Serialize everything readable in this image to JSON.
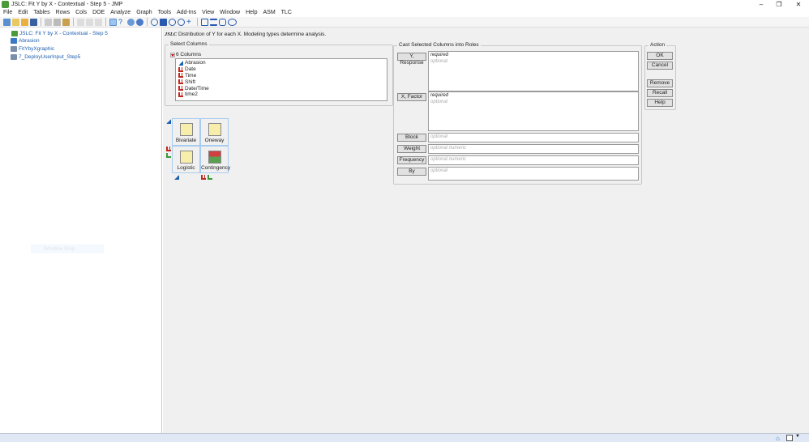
{
  "window": {
    "title": "JSLC: Fit Y by X - Contextual - Step 5 - JMP"
  },
  "menu": [
    "File",
    "Edit",
    "Tables",
    "Rows",
    "Cols",
    "DOE",
    "Analyze",
    "Graph",
    "Tools",
    "Add-Ins",
    "View",
    "Window",
    "Help",
    "ASM",
    "TLC"
  ],
  "tree": [
    "JSLC: Fit Y by X - Contextual - Step 5",
    "Abrasion",
    "FitYbyXgraphic",
    "7_DeployUserInput_Step5"
  ],
  "snip": "Window Snip",
  "header": {
    "badge": "JSLC",
    "text": "Distribution of Y for each X.  Modeling types determine analysis."
  },
  "select": {
    "legend": "Select Columns",
    "count": "6 Columns",
    "columns": [
      {
        "name": "Abrasion",
        "type": "continuous"
      },
      {
        "name": "Date",
        "type": "nominal"
      },
      {
        "name": "Time",
        "type": "nominal"
      },
      {
        "name": "Shift",
        "type": "nominal"
      },
      {
        "name": "Date/Time",
        "type": "nominal"
      },
      {
        "name": "time2",
        "type": "nominal"
      }
    ]
  },
  "platforms": [
    "Bivariate",
    "Oneway",
    "Logistic",
    "Contingency"
  ],
  "cast": {
    "legend": "Cast Selected Columns into Roles",
    "roles": [
      {
        "label": "Y, Response",
        "hint1": "required",
        "hint2": "optional"
      },
      {
        "label": "X, Factor",
        "hint1": "required",
        "hint2": "optional"
      },
      {
        "label": "Block",
        "hint2": "optional"
      },
      {
        "label": "Weight",
        "hint2": "optional numeric"
      },
      {
        "label": "Frequency",
        "hint2": "optional numeric"
      },
      {
        "label": "By",
        "hint2": "optional"
      }
    ]
  },
  "action": {
    "legend": "Action",
    "ok": "OK",
    "cancel": "Cancel",
    "remove": "Remove",
    "recall": "Recall",
    "help": "Help"
  }
}
